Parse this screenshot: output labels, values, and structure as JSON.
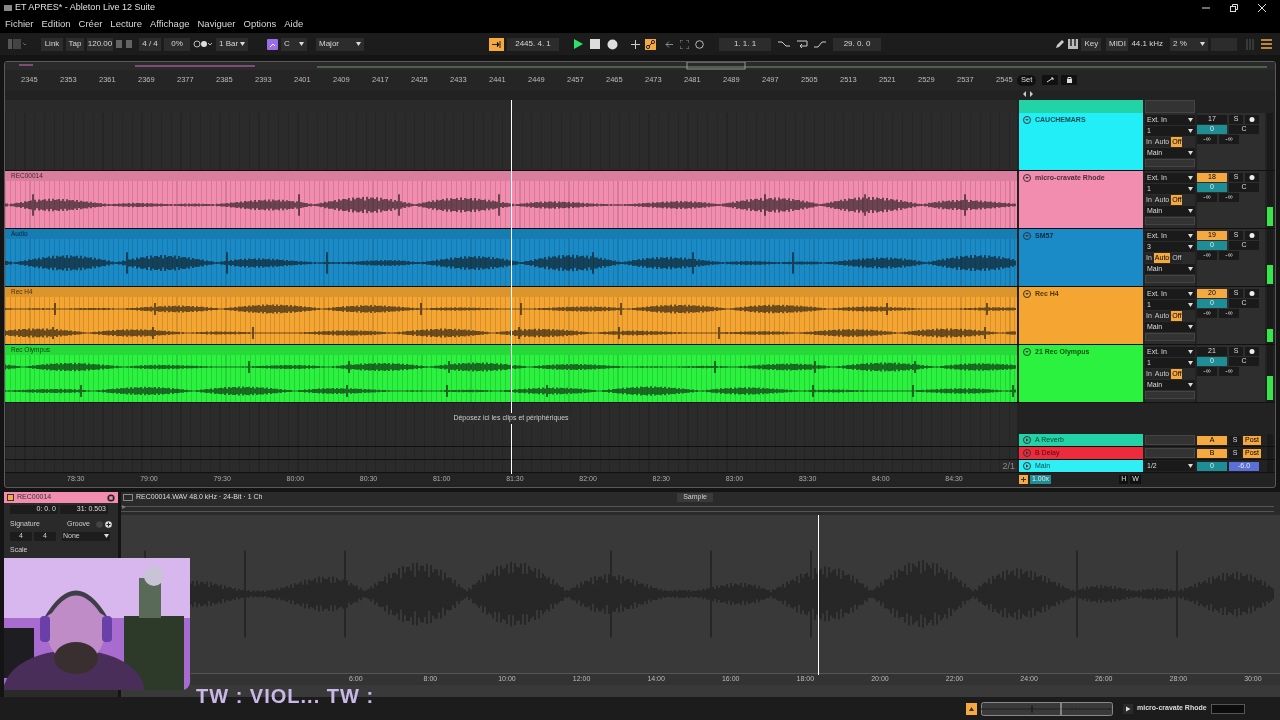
{
  "window": {
    "title": "ET APRES* - Ableton Live 12 Suite"
  },
  "menu": [
    "Fichier",
    "Edition",
    "Créer",
    "Lecture",
    "Affichage",
    "Naviguer",
    "Options",
    "Aide"
  ],
  "control_bar": {
    "link": "Link",
    "tap": "Tap",
    "tempo": "120.00",
    "signature": "4 / 4",
    "groove": "0%",
    "quantize": "1 Bar",
    "key": "C",
    "scale": "Major",
    "position": "2445.  4.  1",
    "playing": true,
    "recording": false,
    "loop_start": "1.  1.  1",
    "loop_length": "29.  0.  0",
    "key_map": "Key",
    "midi_map": "MIDI",
    "sample_rate": "44.1 kHz",
    "cpu": "2 %"
  },
  "ruler": {
    "beats": [
      "2345",
      "2353",
      "2361",
      "2369",
      "2377",
      "2385",
      "2393",
      "2401",
      "2409",
      "2417",
      "2425",
      "2433",
      "2441",
      "2449",
      "2457",
      "2465",
      "2473",
      "2481",
      "2489",
      "2497",
      "2505",
      "2513",
      "2521",
      "2529",
      "2537",
      "2545"
    ],
    "set": "Set"
  },
  "tracks": [
    {
      "name": "CAUCHEMARS",
      "color": "#22eef8",
      "input": "Ext. In",
      "input_channel": "1",
      "monitor": [
        {
          "label": "In",
          "selected": false
        },
        {
          "label": "Auto",
          "selected": false
        },
        {
          "label": "Off",
          "selected": true
        }
      ],
      "output": "Main",
      "number": "17",
      "active": false,
      "solo": "S",
      "volume": "0",
      "pan": "C",
      "sends": [
        "-∞",
        "-∞"
      ],
      "level": 0
    },
    {
      "name": "micro-cravate Rhode",
      "color": "#f28db0",
      "clip": {
        "label": "REC00014",
        "stereo": false
      },
      "input": "Ext. In",
      "input_channel": "1",
      "monitor": [
        {
          "label": "In",
          "selected": false
        },
        {
          "label": "Auto",
          "selected": false
        },
        {
          "label": "Off",
          "selected": true
        }
      ],
      "output": "Main",
      "number": "18",
      "active": true,
      "solo": "S",
      "volume": "0",
      "pan": "C",
      "sends": [
        "-∞",
        "-∞"
      ],
      "level": 0.35
    },
    {
      "name": "SM57",
      "color": "#1a8bc6",
      "clip": {
        "label": "Audio",
        "stereo": false
      },
      "input": "Ext. In",
      "input_channel": "3",
      "monitor": [
        {
          "label": "In",
          "selected": false
        },
        {
          "label": "Auto",
          "selected": true
        },
        {
          "label": "Off",
          "selected": false
        }
      ],
      "output": "Main",
      "number": "19",
      "active": true,
      "solo": "S",
      "volume": "0",
      "pan": "C",
      "sends": [
        "-∞",
        "-∞"
      ],
      "level": 0.35
    },
    {
      "name": "Rec H4",
      "color": "#f5a531",
      "clip": {
        "label": "Rec H4",
        "stereo": true
      },
      "input": "Ext. In",
      "input_channel": "1",
      "monitor": [
        {
          "label": "In",
          "selected": false
        },
        {
          "label": "Auto",
          "selected": false
        },
        {
          "label": "Off",
          "selected": true
        }
      ],
      "output": "Main",
      "number": "20",
      "active": true,
      "solo": "S",
      "volume": "0",
      "pan": "C",
      "sends": [
        "-∞",
        "-∞"
      ],
      "level": 0.25
    },
    {
      "name": "21 Rec Olympus",
      "color": "#2bf23f",
      "clip": {
        "label": "Rec Olympus",
        "stereo": true
      },
      "input": "Ext. In",
      "input_channel": "1",
      "monitor": [
        {
          "label": "In",
          "selected": false
        },
        {
          "label": "Auto",
          "selected": false
        },
        {
          "label": "Off",
          "selected": true
        }
      ],
      "output": "Main",
      "number": "21",
      "active": false,
      "solo": "S",
      "volume": "0",
      "pan": "C",
      "sends": [
        "-∞",
        "-∞"
      ],
      "level": 0.45
    }
  ],
  "drop_hint": "Déposez ici les clips et périphériques",
  "returns": [
    {
      "name": "A Reverb",
      "color": "#22d3a8",
      "send": "A",
      "solo": "S",
      "post": "Post"
    },
    {
      "name": "B Delay",
      "color": "#ee2a3d",
      "send": "B",
      "solo": "S",
      "post": "Post"
    }
  ],
  "main": {
    "name": "Main",
    "color": "#2ef0f4",
    "output": "1/2",
    "volume": "0",
    "gain": "-6.0"
  },
  "arrangement_footer": {
    "grid": "2/1",
    "zoom": "1.00x",
    "h": "H",
    "w": "W"
  },
  "time_ruler": [
    "78:30",
    "79:00",
    "79:30",
    "80:00",
    "80:30",
    "81:00",
    "81:30",
    "82:00",
    "82:30",
    "83:00",
    "83:30",
    "84:00",
    "84:30"
  ],
  "clip_view": {
    "clip_name": "REC00014",
    "start": "0:  0.  0",
    "end": "31:  0.503",
    "signature_label": "Signature",
    "groove_label": "Groove",
    "signature_numerator": "4",
    "signature_denominator": "4",
    "groove": "None",
    "scale_label": "Scale",
    "file_info": "REC00014.WAV  48.0 kHz · 24-Bit · 1 Ch",
    "tab": "Sample",
    "ruler": [
      "6:00",
      "8:00",
      "10:00",
      "12:00",
      "14:00",
      "16:00",
      "18:00",
      "20:00",
      "22:00",
      "24:00",
      "26:00",
      "28:00",
      "30:00"
    ]
  },
  "overlay_text": "TW : VIOL... TW :",
  "status_bar": {
    "track": "micro-cravate Rhode"
  }
}
